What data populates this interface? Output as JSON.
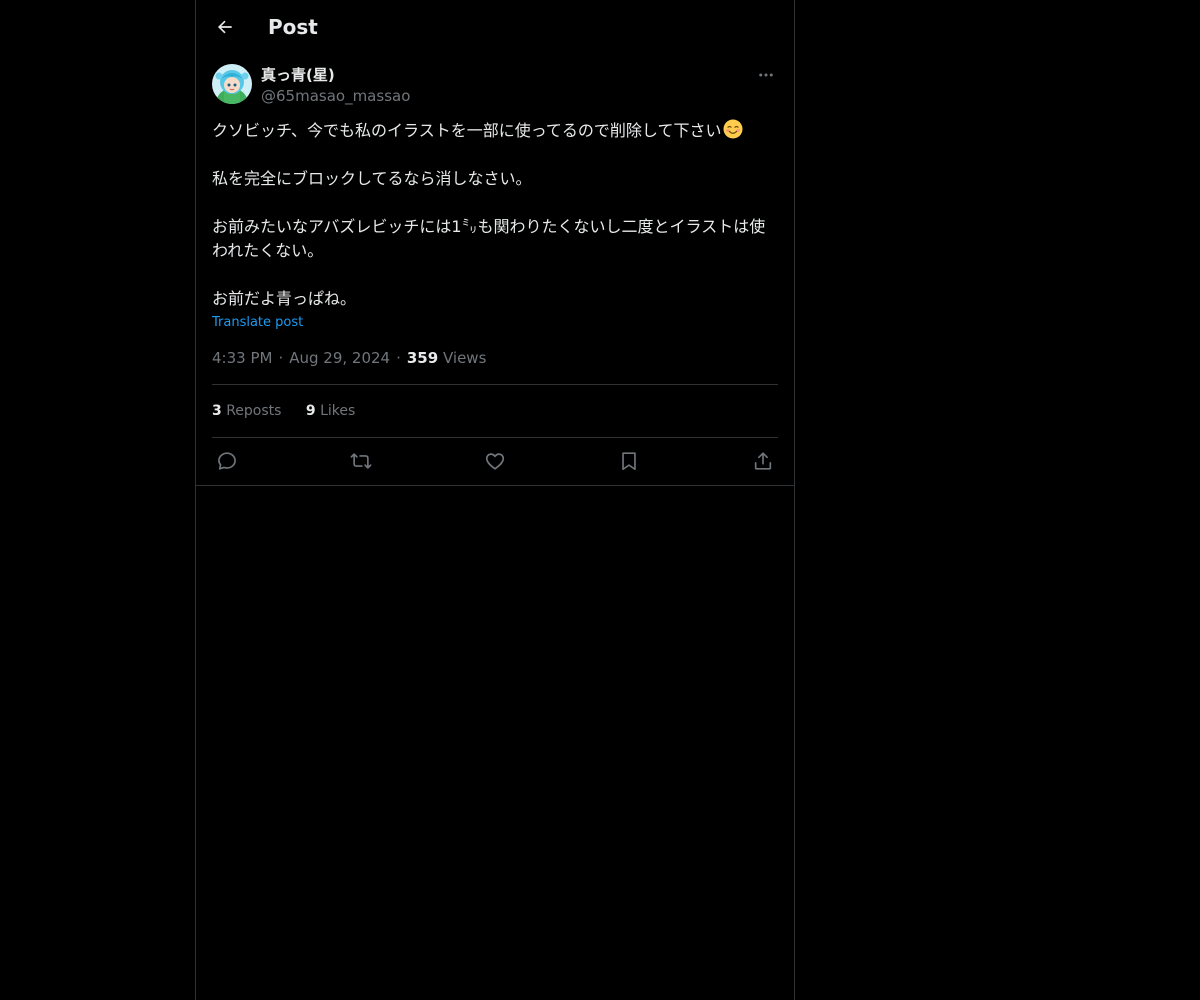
{
  "header": {
    "title": "Post"
  },
  "post": {
    "author": {
      "display_name": "真っ青(星)",
      "handle": "@65masao_massao",
      "avatar": "anime-character-avatar"
    },
    "paragraphs": [
      "クソビッチ、今でも私のイラストを一部に使ってるので削除して下さい",
      "私を完全にブロックしてるなら消しなさい。",
      "お前みたいなアバズレビッチには1㍉も関わりたくないし二度とイラストは使われたくない。",
      "お前だよ青っぱね。"
    ],
    "emoji": "smiling-face-emoji",
    "translate_label": "Translate post",
    "time": "4:33 PM",
    "date": "Aug 29, 2024",
    "separator": "·",
    "views_count": "359",
    "views_label": "Views",
    "reposts_count": "3",
    "reposts_label": "Reposts",
    "likes_count": "9",
    "likes_label": "Likes"
  },
  "icons": {
    "back": "arrow-left-icon",
    "more": "more-horizontal-icon",
    "reply": "reply-icon",
    "repost": "repost-icon",
    "like": "heart-icon",
    "bookmark": "bookmark-icon",
    "share": "share-icon"
  },
  "colors": {
    "background": "#000000",
    "text": "#e7e9ea",
    "secondary_text": "#71767b",
    "link": "#1d9bf0",
    "border": "#2f3336"
  }
}
